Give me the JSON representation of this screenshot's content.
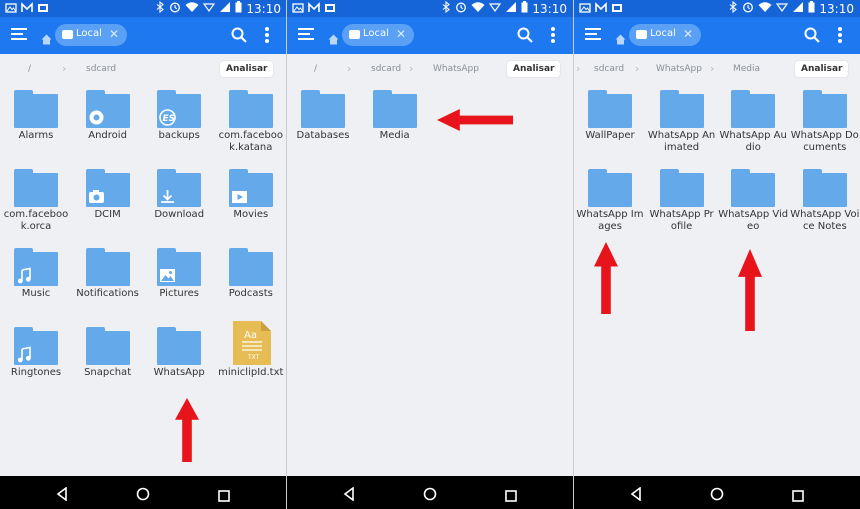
{
  "status": {
    "time": "13:10"
  },
  "panels": [
    {
      "chip_label": "Local",
      "breadcrumbs": [
        "/",
        "sdcard"
      ],
      "analyze_label": "Analisar",
      "items": [
        {
          "label": "Alarms",
          "type": "folder",
          "badge": ""
        },
        {
          "label": "Android",
          "type": "folder",
          "badge": "gear"
        },
        {
          "label": "backups",
          "type": "folder",
          "badge": "es"
        },
        {
          "label": "com.facebook.katana",
          "type": "folder",
          "badge": ""
        },
        {
          "label": "com.facebook.orca",
          "type": "folder",
          "badge": ""
        },
        {
          "label": "DCIM",
          "type": "folder",
          "badge": "camera"
        },
        {
          "label": "Download",
          "type": "folder",
          "badge": "download"
        },
        {
          "label": "Movies",
          "type": "folder",
          "badge": "play"
        },
        {
          "label": "Music",
          "type": "folder",
          "badge": "music"
        },
        {
          "label": "Notifications",
          "type": "folder",
          "badge": ""
        },
        {
          "label": "Pictures",
          "type": "folder",
          "badge": "image"
        },
        {
          "label": "Podcasts",
          "type": "folder",
          "badge": ""
        },
        {
          "label": "Ringtones",
          "type": "folder",
          "badge": "music"
        },
        {
          "label": "Snapchat",
          "type": "folder",
          "badge": ""
        },
        {
          "label": "WhatsApp",
          "type": "folder",
          "badge": ""
        },
        {
          "label": "miniclipId.txt",
          "type": "txt",
          "badge": ""
        }
      ]
    },
    {
      "chip_label": "Local",
      "breadcrumbs": [
        "/",
        "sdcard",
        "WhatsApp"
      ],
      "analyze_label": "Analisar",
      "items": [
        {
          "label": "Databases",
          "type": "folder",
          "badge": ""
        },
        {
          "label": "Media",
          "type": "folder",
          "badge": ""
        }
      ]
    },
    {
      "chip_label": "Local",
      "breadcrumbs": [
        "sdcard",
        "WhatsApp",
        "Media"
      ],
      "analyze_label": "Analisar",
      "items": [
        {
          "label": "WallPaper",
          "type": "folder",
          "badge": ""
        },
        {
          "label": "WhatsApp Animated",
          "type": "folder",
          "badge": ""
        },
        {
          "label": "WhatsApp Audio",
          "type": "folder",
          "badge": ""
        },
        {
          "label": "WhatsApp Documents",
          "type": "folder",
          "badge": ""
        },
        {
          "label": "WhatsApp Images",
          "type": "folder",
          "badge": ""
        },
        {
          "label": "WhatsApp Profile",
          "type": "folder",
          "badge": ""
        },
        {
          "label": "WhatsApp Video",
          "type": "folder",
          "badge": ""
        },
        {
          "label": "WhatsApp Voice Notes",
          "type": "folder",
          "badge": ""
        }
      ]
    }
  ],
  "file_badge": {
    "top": "Aa",
    "bottom": "TXT"
  },
  "colors": {
    "statusbar": "#1565d8",
    "appbar": "#1e78f0",
    "folder": "#64a9ea",
    "arrow": "#e8141c",
    "txt_file": "#e6bd55"
  },
  "icons": [
    "hamburger-icon",
    "home-icon",
    "storage-icon",
    "close-icon",
    "search-icon",
    "more-vert-icon",
    "back-icon",
    "home-circle-icon",
    "recents-icon"
  ]
}
